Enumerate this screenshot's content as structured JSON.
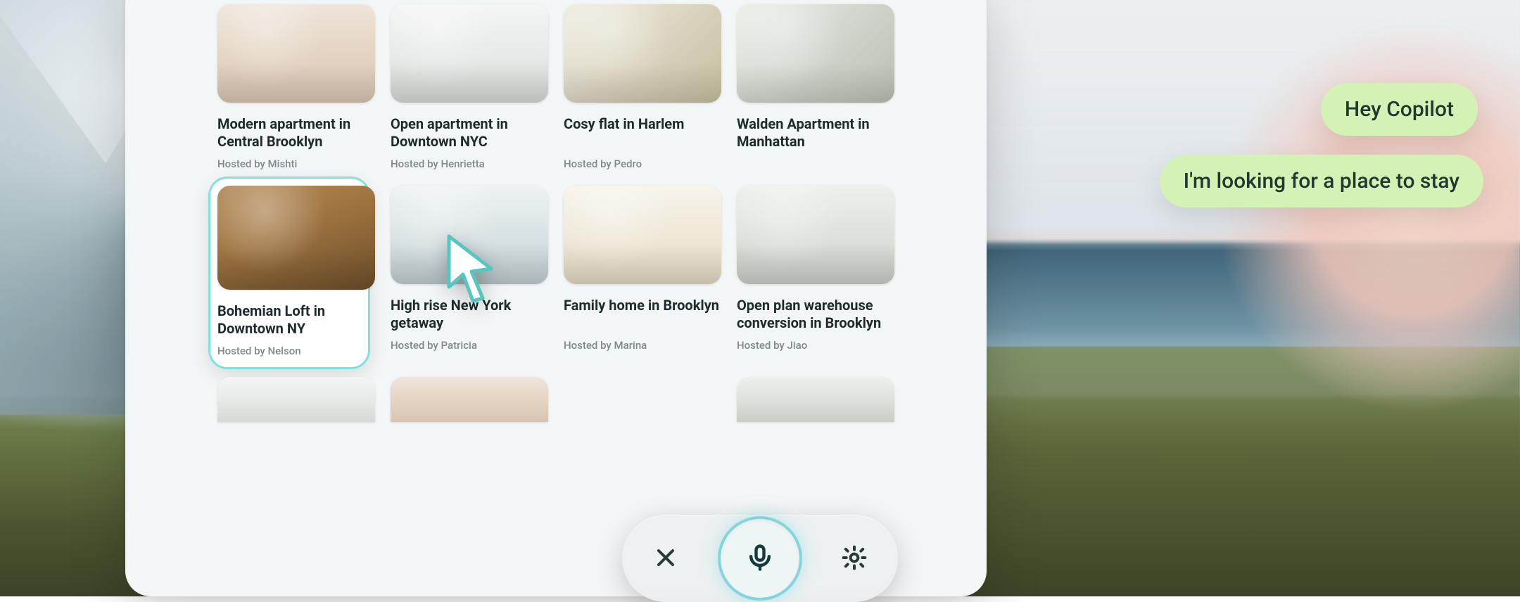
{
  "listings": [
    {
      "title": "Modern apartment in Central Brooklyn",
      "host": "Hosted by Mishti"
    },
    {
      "title": "Open apartment in Downtown NYC",
      "host": "Hosted by Henrietta"
    },
    {
      "title": "Cosy flat in Harlem",
      "host": "Hosted by Pedro"
    },
    {
      "title": "Walden Apartment in Manhattan",
      "host": ""
    },
    {
      "title": "Bohemian Loft in Downtown NY",
      "host": "Hosted by Nelson"
    },
    {
      "title": "High rise New York getaway",
      "host": "Hosted by Patricia"
    },
    {
      "title": "Family home in Brooklyn",
      "host": "Hosted by Marina"
    },
    {
      "title": "Open plan warehouse conversion in Brooklyn",
      "host": "Hosted by Jiao"
    }
  ],
  "selected_index": 4,
  "chat": {
    "bubble1": "Hey Copilot",
    "bubble2": "I'm looking for a place to stay"
  },
  "toolbar": {
    "close": "close-icon",
    "mic": "microphone-icon",
    "settings": "gear-icon"
  },
  "colors": {
    "bubble_bg": "#d5f2b6",
    "selection_ring": "#7fe2dc",
    "mic_glow": "#45c5d2"
  }
}
